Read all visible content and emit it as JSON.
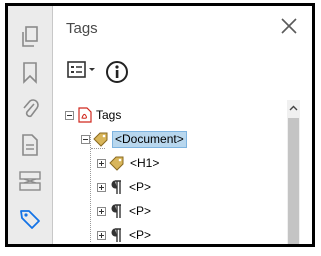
{
  "panel": {
    "title": "Tags"
  },
  "rail": {
    "items": [
      {
        "name": "pages-icon",
        "active": false
      },
      {
        "name": "bookmark-icon",
        "active": false
      },
      {
        "name": "attachment-icon",
        "active": false
      },
      {
        "name": "document-properties-icon",
        "active": false
      },
      {
        "name": "content-order-icon",
        "active": false
      },
      {
        "name": "tag-icon",
        "active": true
      }
    ]
  },
  "toolbar": {
    "options_icon": "list-options-icon",
    "info_icon": "info-icon"
  },
  "tree": {
    "root": {
      "label": "Tags",
      "expanded": true
    },
    "document": {
      "label": "<Document>",
      "selected": true,
      "expanded": true
    },
    "children": [
      {
        "label": "<H1>",
        "icon": "tag-icon"
      },
      {
        "label": "<P>",
        "icon": "paragraph-icon"
      },
      {
        "label": "<P>",
        "icon": "paragraph-icon"
      },
      {
        "label": "<P>",
        "icon": "paragraph-icon"
      }
    ]
  },
  "colors": {
    "selection": "#b8d7ee",
    "tag_accent": "#c8a04a",
    "pdf_red": "#d0281e",
    "active_icon": "#1473e6"
  }
}
